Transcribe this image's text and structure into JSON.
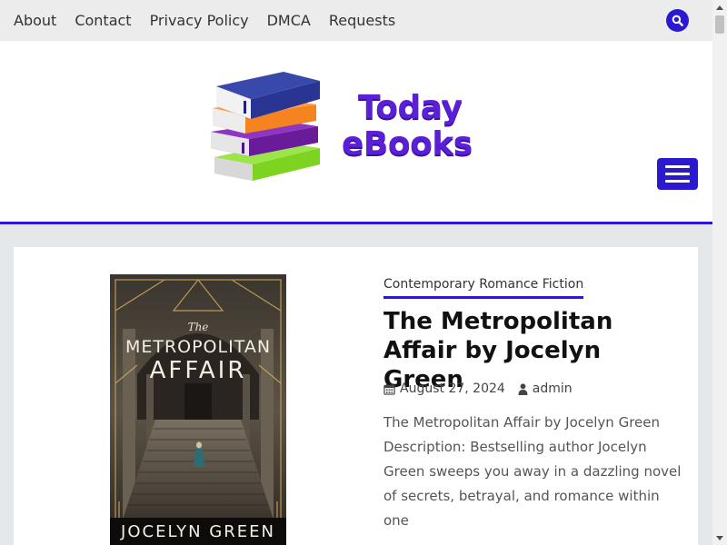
{
  "topnav": {
    "items": [
      "About",
      "Contact",
      "Privacy Policy",
      "DMCA",
      "Requests"
    ]
  },
  "icons": {
    "search": "search-icon",
    "menu": "hamburger-menu-icon",
    "calendar": "calendar-icon",
    "user": "user-icon"
  },
  "site": {
    "logo_line1": "Today",
    "logo_line2": "eBooks"
  },
  "colors": {
    "accent": "#2a19d1",
    "topbar_bg": "#ececec",
    "content_bg": "#e5e8ea",
    "logo_text": "#5b1fd6"
  },
  "post": {
    "category": "Contemporary Romance Fiction",
    "title": "The Metropolitan Affair by Jocelyn Green",
    "date": "August 27, 2024",
    "author": "admin",
    "excerpt": "The Metropolitan Affair by Jocelyn Green Description: Bestselling author Jocelyn Green sweeps you away in a dazzling novel of secrets, betrayal, and romance within one",
    "cover": {
      "title_small": "The",
      "title_line1": "METROPOLITAN",
      "title_line2": "AFFAIR",
      "author": "JOCELYN GREEN"
    }
  }
}
